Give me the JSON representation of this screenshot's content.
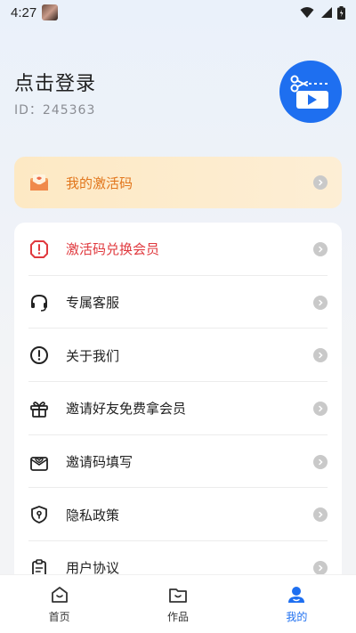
{
  "status_bar": {
    "time": "4:27"
  },
  "header": {
    "login_title": "点击登录",
    "id_label": "ID：",
    "id_value": "245363"
  },
  "activation_card": {
    "label": "我的激活码",
    "icon": "envelope-icon"
  },
  "menu": {
    "items": [
      {
        "label": "激活码兑换会员",
        "icon": "shield-alert-icon",
        "highlight": true
      },
      {
        "label": "专属客服",
        "icon": "headset-icon"
      },
      {
        "label": "关于我们",
        "icon": "info-circle-icon"
      },
      {
        "label": "邀请好友免费拿会员",
        "icon": "gift-icon"
      },
      {
        "label": "邀请码填写",
        "icon": "mail-heart-icon"
      },
      {
        "label": "隐私政策",
        "icon": "privacy-shield-icon"
      },
      {
        "label": "用户协议",
        "icon": "clipboard-icon"
      }
    ]
  },
  "bottom_nav": {
    "tabs": [
      {
        "label": "首页",
        "icon": "home-icon",
        "active": false
      },
      {
        "label": "作品",
        "icon": "folder-icon",
        "active": false
      },
      {
        "label": "我的",
        "icon": "user-icon",
        "active": true
      }
    ]
  },
  "colors": {
    "accent": "#1e6ff0",
    "warning_text": "#e2761c",
    "danger_text": "#e0393e"
  }
}
